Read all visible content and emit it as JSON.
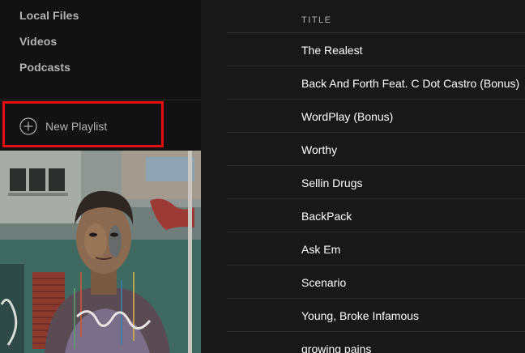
{
  "sidebar": {
    "items": [
      {
        "label": "Local Files"
      },
      {
        "label": "Videos"
      },
      {
        "label": "Podcasts"
      }
    ],
    "new_playlist_label": "New Playlist"
  },
  "tracklist": {
    "column_title": "TITLE",
    "tracks": [
      {
        "title": "The Realest"
      },
      {
        "title": "Back And Forth Feat. C Dot Castro (Bonus)"
      },
      {
        "title": "WordPlay (Bonus)"
      },
      {
        "title": "Worthy"
      },
      {
        "title": "Sellin Drugs"
      },
      {
        "title": "BackPack"
      },
      {
        "title": "Ask Em"
      },
      {
        "title": "Scenario"
      },
      {
        "title": "Young, Broke Infamous"
      },
      {
        "title": "growing pains"
      }
    ]
  },
  "colors": {
    "sidebar_bg": "#121212",
    "main_bg": "#181818",
    "highlight": "#e01010",
    "text_primary": "#ffffff",
    "text_secondary": "#b3b3b3"
  },
  "icons": {
    "new_playlist": "plus-circle-icon"
  }
}
